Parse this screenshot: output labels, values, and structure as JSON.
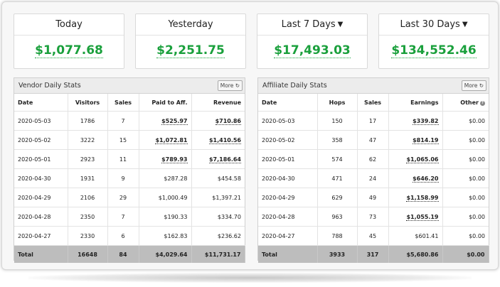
{
  "cards": [
    {
      "label": "Today",
      "value": "$1,077.68",
      "dropdown": false
    },
    {
      "label": "Yesterday",
      "value": "$2,251.75",
      "dropdown": false
    },
    {
      "label": "Last 7 Days",
      "value": "$17,493.03",
      "dropdown": true
    },
    {
      "label": "Last 30 Days",
      "value": "$134,552.46",
      "dropdown": true
    }
  ],
  "vendor": {
    "title": "Vendor Daily Stats",
    "more_label": "More",
    "columns": [
      "Date",
      "Visitors",
      "Sales",
      "Paid to Aff.",
      "Revenue"
    ],
    "rows": [
      [
        "2020-05-03",
        "1786",
        "7",
        "$525.97",
        "$710.86"
      ],
      [
        "2020-05-02",
        "3222",
        "15",
        "$1,072.81",
        "$1,410.56"
      ],
      [
        "2020-05-01",
        "2923",
        "11",
        "$789.93",
        "$7,186.64"
      ],
      [
        "2020-04-30",
        "1931",
        "9",
        "$287.28",
        "$454.58"
      ],
      [
        "2020-04-29",
        "2106",
        "29",
        "$1,000.49",
        "$1,397.21"
      ],
      [
        "2020-04-28",
        "2350",
        "7",
        "$190.33",
        "$334.70"
      ],
      [
        "2020-04-27",
        "2330",
        "6",
        "$162.83",
        "$236.62"
      ]
    ],
    "total": [
      "Total",
      "16648",
      "84",
      "$4,029.64",
      "$11,731.17"
    ]
  },
  "affiliate": {
    "title": "Affiliate Daily Stats",
    "more_label": "More",
    "columns": [
      "Date",
      "Hops",
      "Sales",
      "Earnings",
      "Other"
    ],
    "rows": [
      [
        "2020-05-03",
        "150",
        "17",
        "$339.82",
        "$0.00"
      ],
      [
        "2020-05-02",
        "358",
        "47",
        "$814.19",
        "$0.00"
      ],
      [
        "2020-05-01",
        "574",
        "62",
        "$1,065.06",
        "$0.00"
      ],
      [
        "2020-04-30",
        "471",
        "24",
        "$646.20",
        "$0.00"
      ],
      [
        "2020-04-29",
        "629",
        "49",
        "$1,158.99",
        "$0.00"
      ],
      [
        "2020-04-28",
        "963",
        "73",
        "$1,055.19",
        "$0.00"
      ],
      [
        "2020-04-27",
        "788",
        "45",
        "$601.41",
        "$0.00"
      ]
    ],
    "total": [
      "Total",
      "3933",
      "317",
      "$5,680.86",
      "$0.00"
    ]
  },
  "colors": {
    "value_green": "#1aa03c",
    "total_row": "#bdbdbd"
  }
}
